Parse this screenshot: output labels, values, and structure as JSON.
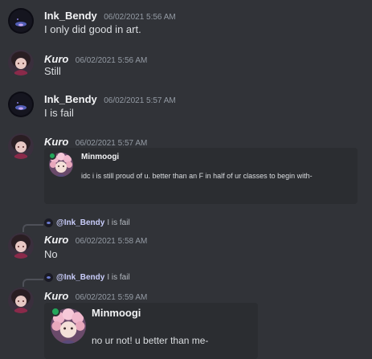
{
  "messages": [
    {
      "username": "Ink_Bendy",
      "timestamp": "06/02/2021 5:56 AM",
      "content": "I only did good in art.",
      "avatar_icon": "dark-orb-avatar"
    },
    {
      "username": "Kuro",
      "timestamp": "06/02/2021 5:56 AM",
      "content": "Still",
      "avatar_icon": "anime-girl-avatar"
    },
    {
      "username": "Ink_Bendy",
      "timestamp": "06/02/2021 5:57 AM",
      "content": "I is fail",
      "avatar_icon": "dark-orb-avatar"
    },
    {
      "username": "Kuro",
      "timestamp": "06/02/2021 5:57 AM",
      "avatar_icon": "anime-girl-avatar",
      "embed": {
        "name": "Minmoogi",
        "text": "idc i is still proud of u. better than an F in half of ur classes to begin with-"
      }
    },
    {
      "reply": {
        "mention": "@Ink_Bendy",
        "text": "I is fail"
      },
      "username": "Kuro",
      "timestamp": "06/02/2021 5:58 AM",
      "content": "No",
      "avatar_icon": "anime-girl-avatar"
    },
    {
      "reply": {
        "mention": "@Ink_Bendy",
        "text": "I is fail"
      },
      "username": "Kuro",
      "timestamp": "06/02/2021 5:59 AM",
      "avatar_icon": "anime-girl-avatar",
      "embed": {
        "name": "Minmoogi",
        "text": "no ur not! u better than me-"
      }
    }
  ],
  "colors": {
    "background": "#313338",
    "embed_background": "#2b2d31",
    "username": "#f2f3f5",
    "timestamp": "#949ba4",
    "text": "#dbdee1",
    "online_status": "#23a55a"
  }
}
